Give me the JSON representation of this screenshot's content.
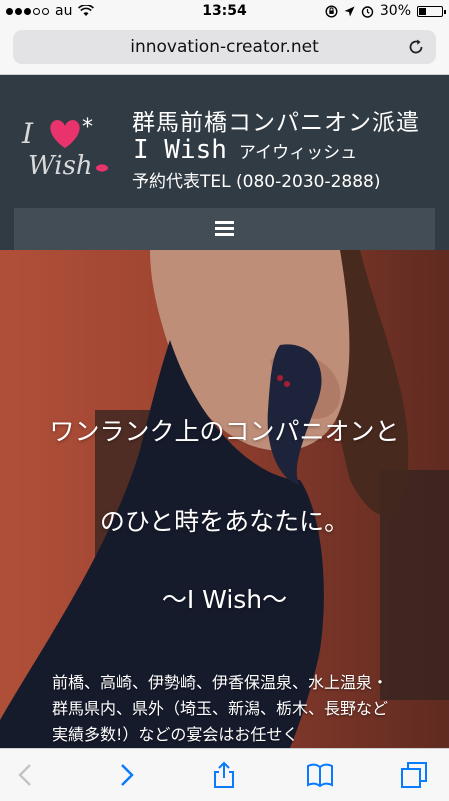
{
  "status_bar": {
    "carrier": "au",
    "time": "13:54",
    "battery_percent": "30%",
    "battery_level": 0.3
  },
  "browser": {
    "url": "innovation-creator.net"
  },
  "header": {
    "logo_alt": "I Wish",
    "title_line1": "群馬前橋コンパニオン派遣",
    "brand_name": "I Wish",
    "brand_kana": "アイウィッシュ",
    "tel": "予約代表TEL (080-2030-2888)"
  },
  "hero": {
    "tagline_line1": "ワンランク上のコンパニオンと",
    "tagline_line2": "のひと時をあなたに。",
    "tagline_line3": "〜I Wish〜",
    "description": "前橋、高崎、伊勢崎、伊香保温泉、水上温泉・群馬県内、県外（埼玉、新潟、栃木、長野など実績多数!）などの宴会はお任せく"
  },
  "colors": {
    "header_bg": "#313b44",
    "nav_bg": "#434d56",
    "accent_pink": "#e8336d",
    "ios_blue": "#0a7aff"
  }
}
